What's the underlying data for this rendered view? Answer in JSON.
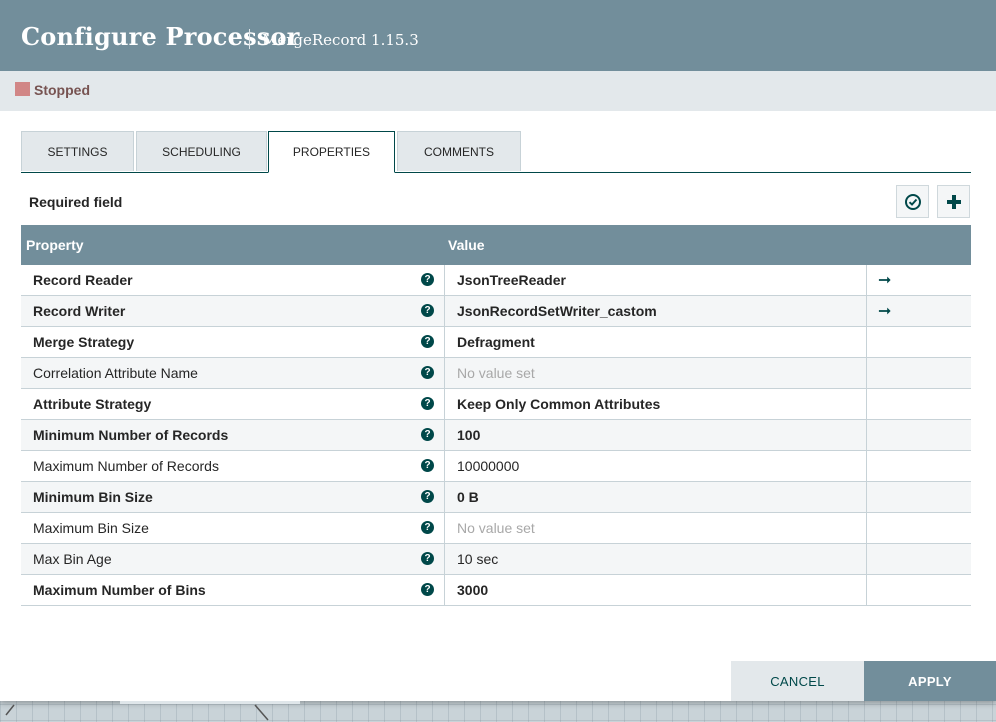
{
  "dialog": {
    "title": "Configure Processor",
    "subtitle": "MergeRecord 1.15.3"
  },
  "status": {
    "text": "Stopped",
    "color": "#d18686"
  },
  "tabs": [
    {
      "label": "SETTINGS",
      "active": false
    },
    {
      "label": "SCHEDULING",
      "active": false
    },
    {
      "label": "PROPERTIES",
      "active": true
    },
    {
      "label": "COMMENTS",
      "active": false
    }
  ],
  "properties": {
    "required_label": "Required field",
    "headers": {
      "property": "Property",
      "value": "Value"
    },
    "rows": [
      {
        "name": "Record Reader",
        "value": "JsonTreeReader"
      },
      {
        "name": "Record Writer",
        "value": "JsonRecordSetWriter_castom"
      },
      {
        "name": "Merge Strategy",
        "value": "Defragment"
      },
      {
        "name": "Correlation Attribute Name",
        "value": "No value set"
      },
      {
        "name": "Attribute Strategy",
        "value": "Keep Only Common Attributes"
      },
      {
        "name": "Minimum Number of Records",
        "value": "100"
      },
      {
        "name": "Maximum Number of Records",
        "value": "10000000"
      },
      {
        "name": "Minimum Bin Size",
        "value": "0 B"
      },
      {
        "name": "Maximum Bin Size",
        "value": "No value set"
      },
      {
        "name": "Max Bin Age",
        "value": "10 sec"
      },
      {
        "name": "Maximum Number of Bins",
        "value": "3000"
      }
    ]
  },
  "buttons": {
    "cancel": "CANCEL",
    "apply": "APPLY"
  },
  "colors": {
    "header": "#728e9b",
    "accent": "#004849"
  }
}
